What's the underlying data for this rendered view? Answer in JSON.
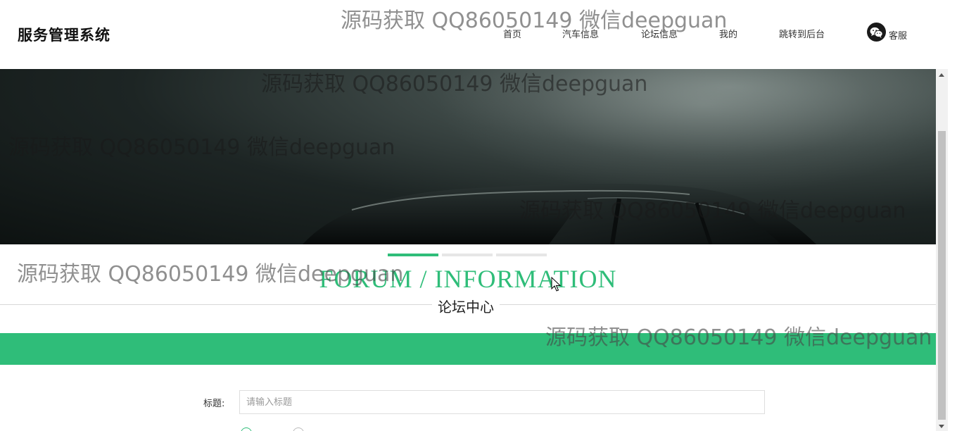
{
  "header": {
    "brand": "服务管理系统",
    "nav": [
      {
        "label": "首页"
      },
      {
        "label": "汽车信息"
      },
      {
        "label": "论坛信息"
      },
      {
        "label": "我的"
      },
      {
        "label": "跳转到后台"
      }
    ],
    "service": {
      "label": "客服",
      "icon": "wechat-icon"
    }
  },
  "banner": {
    "slides": 3,
    "active_slide": 1
  },
  "section": {
    "title_en": "FORUM / INFORMATION",
    "title_cn": "论坛中心"
  },
  "form": {
    "title_label": "标题:",
    "title_placeholder": "请输入标题",
    "title_value": ""
  },
  "watermark": "源码获取 QQ86050149 微信deepguan",
  "colors": {
    "accent": "#2fbd79",
    "text": "#333333"
  }
}
